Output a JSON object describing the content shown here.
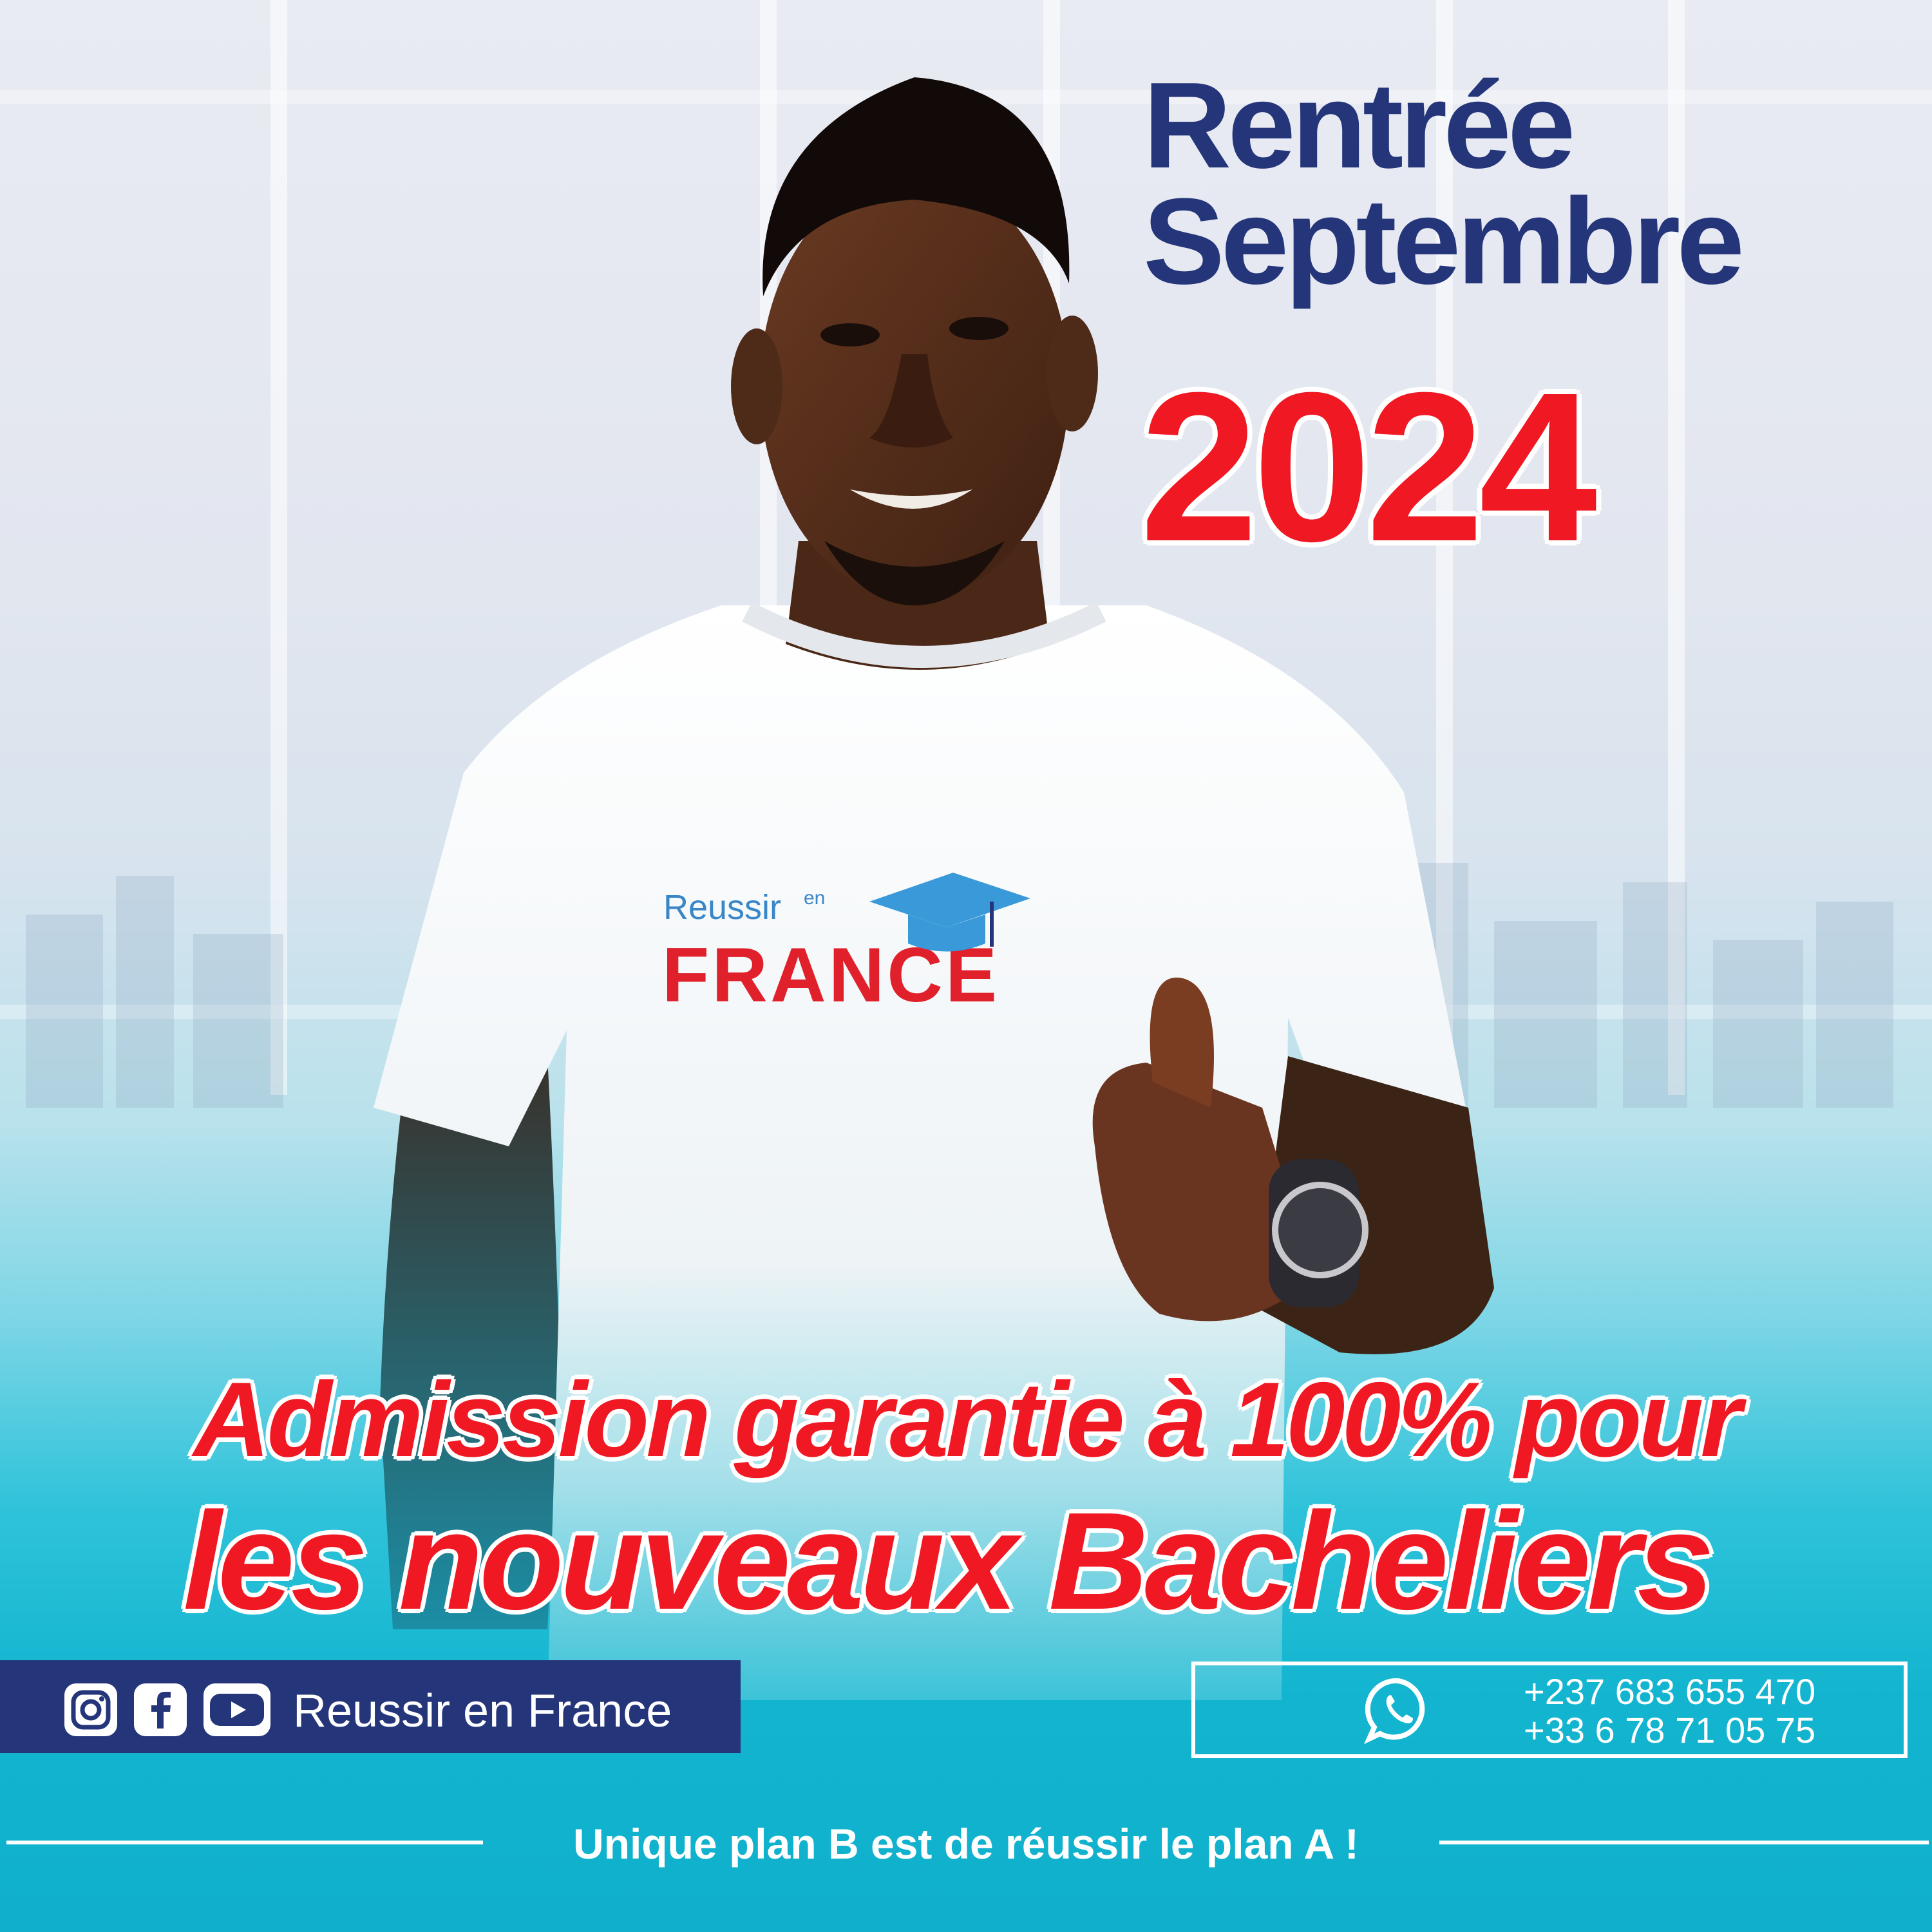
{
  "heading": {
    "line1": "Rentrée",
    "line2": "Septembre",
    "year": "2024"
  },
  "headline": {
    "line1": "Admission garantie à 100% pour",
    "line2": "les nouveaux Bacheliers"
  },
  "shirt_logo": {
    "word1": "Reussir",
    "word2": "en",
    "word3": "FRANCE"
  },
  "social": {
    "icons": [
      "instagram-icon",
      "facebook-icon",
      "youtube-icon"
    ],
    "label": "Reussir en France"
  },
  "contact": {
    "icon": "whatsapp-icon",
    "phone1": "+237 683 655 470",
    "phone2": "+33 6 78 71 05 75"
  },
  "slogan": "Unique plan B est de réussir le plan A !",
  "colors": {
    "navy": "#24357a",
    "red": "#f01822",
    "cyan": "#10b0cc"
  }
}
